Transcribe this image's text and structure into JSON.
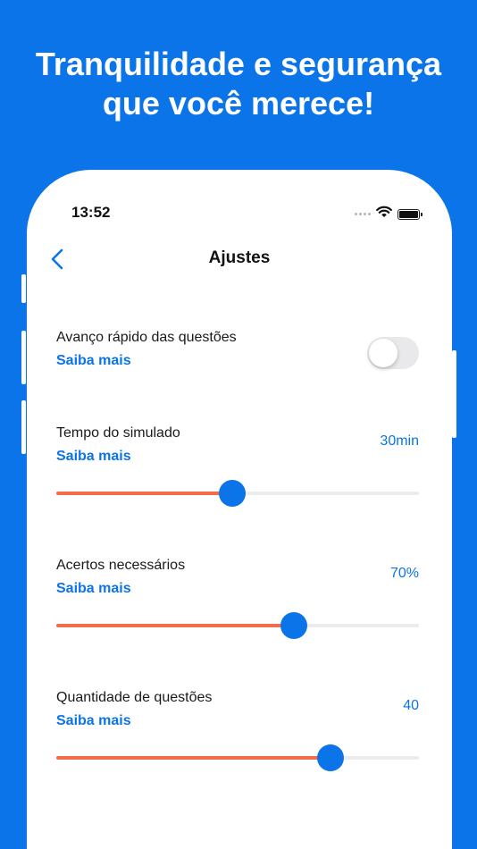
{
  "headline": {
    "line1": "Tranquilidade e segurança",
    "line2": "que você merece!"
  },
  "status_bar": {
    "time": "13:52",
    "icons": [
      "signal-icon",
      "wifi-icon",
      "battery-icon"
    ]
  },
  "navbar": {
    "back_icon": "chevron-left-icon",
    "title": "Ajustes"
  },
  "settings": {
    "fast_advance": {
      "label": "Avanço rápido das questões",
      "more": "Saiba mais",
      "enabled": false
    },
    "sim_time": {
      "label": "Tempo do simulado",
      "more": "Saiba mais",
      "value": "30min",
      "level": 0.485
    },
    "correct_needed": {
      "label": "Acertos necessários",
      "more": "Saiba mais",
      "value": "70%",
      "level": 0.655
    },
    "question_count": {
      "label": "Quantidade de questões",
      "more": "Saiba mais",
      "value": "40",
      "level": 0.757
    }
  },
  "colors": {
    "brand_blue": "#0b74e8",
    "slider_fill": "#f26b4b",
    "slider_track": "#ececef",
    "toggle_off": "#e9e9eb"
  }
}
